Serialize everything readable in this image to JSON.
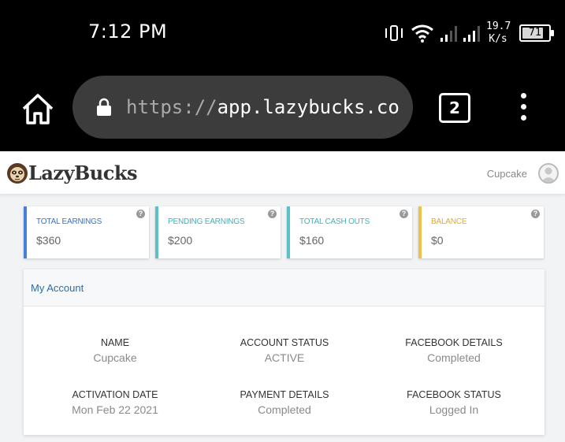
{
  "status_bar": {
    "time": "7:12 PM",
    "net_speed_value": "19.7",
    "net_speed_unit": "K/s",
    "battery_level": "71"
  },
  "browser": {
    "url_scheme": "https://",
    "url_host": "app.lazybucks.co",
    "tab_count": "2"
  },
  "site": {
    "logo_text": "LazyBucks",
    "user_name": "Cupcake"
  },
  "stats": [
    {
      "label": "TOTAL EARNINGS",
      "value": "$360",
      "color": "#4a7fd6",
      "label_color": "#3a6fc4"
    },
    {
      "label": "PENDING EARNINGS",
      "value": "$200",
      "color": "#5bc0c8",
      "label_color": "#46aeb8"
    },
    {
      "label": "TOTAL CASH OUTS",
      "value": "$160",
      "color": "#5bc0c8",
      "label_color": "#46aeb8"
    },
    {
      "label": "BALANCE",
      "value": "$0",
      "color": "#f0c04a",
      "label_color": "#e2a92e"
    }
  ],
  "account": {
    "title": "My Account",
    "fields": [
      {
        "label": "NAME",
        "value": "Cupcake"
      },
      {
        "label": "ACCOUNT STATUS",
        "value": "ACTIVE"
      },
      {
        "label": "FACEBOOK DETAILS",
        "value": "Completed"
      },
      {
        "label": "ACTIVATION DATE",
        "value": "Mon Feb 22 2021"
      },
      {
        "label": "PAYMENT DETAILS",
        "value": "Completed"
      },
      {
        "label": "FACEBOOK STATUS",
        "value": "Logged In"
      }
    ]
  }
}
